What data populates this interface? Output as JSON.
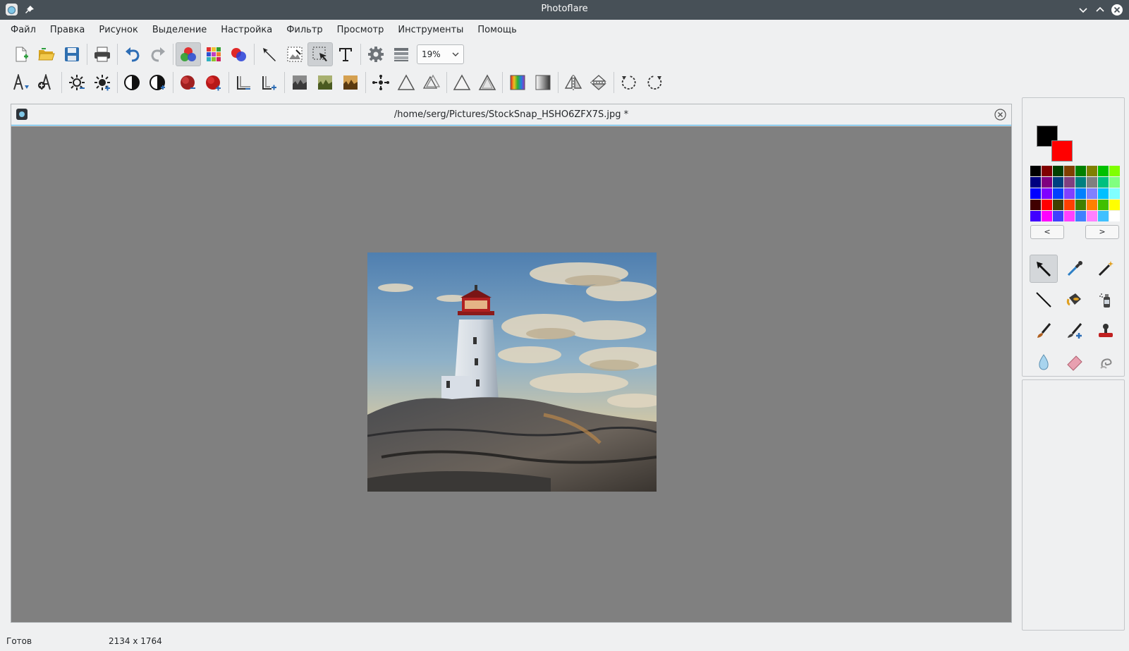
{
  "window": {
    "title": "Photoflare"
  },
  "menu": [
    "Файл",
    "Правка",
    "Рисунок",
    "Выделение",
    "Настройка",
    "Фильтр",
    "Просмотр",
    "Инструменты",
    "Помощь"
  ],
  "toolbar1": {
    "icons": [
      "new-file-icon",
      "open-folder-icon",
      "save-icon",
      "print-icon",
      "undo-icon",
      "redo-icon",
      "color-mode-icon",
      "palette-icon",
      "color-blend-icon",
      "pointer-icon",
      "crop-icon",
      "selection-icon",
      "text-icon",
      "settings-gear-icon",
      "layers-list-icon"
    ],
    "zoom_value": "19%"
  },
  "toolbar2": {
    "icons": [
      "text-down-icon",
      "text-up-icon",
      "brightness-down-icon",
      "brightness-up-icon",
      "contrast-down-icon",
      "contrast-up-icon",
      "saturation-down-icon",
      "saturation-up-icon",
      "gamma-down-icon",
      "gamma-up-icon",
      "levels-dark-icon",
      "levels-green-icon",
      "levels-warm-icon",
      "sharpen-icon",
      "triangle-outline-icon",
      "triangle-double-icon",
      "triangle-plain-icon",
      "triangle-shaded-icon",
      "gradient-color-icon",
      "gradient-gray-icon",
      "flip-horizontal-icon",
      "flip-vertical-icon",
      "rotate-ccw-icon",
      "rotate-cw-icon"
    ]
  },
  "document": {
    "title": "/home/serg/Pictures/StockSnap_HSHO6ZFX7S.jpg *"
  },
  "colors": {
    "primary": "#000000",
    "secondary": "#ff0000",
    "accent": "#3daee9",
    "canvas_bg": "#808080",
    "palette": [
      "#000000",
      "#800000",
      "#004000",
      "#804000",
      "#008000",
      "#808000",
      "#00c000",
      "#80ff00",
      "#000080",
      "#800080",
      "#004080",
      "#804080",
      "#008080",
      "#808080",
      "#00c080",
      "#80ff80",
      "#0000ff",
      "#8000ff",
      "#0040ff",
      "#8040ff",
      "#0080ff",
      "#8080ff",
      "#00c0ff",
      "#80ffff",
      "#400000",
      "#ff0000",
      "#404000",
      "#ff4000",
      "#408000",
      "#ff8000",
      "#40c000",
      "#ffff00",
      "#4000ff",
      "#ff00ff",
      "#4040ff",
      "#ff40ff",
      "#4080ff",
      "#ff80ff",
      "#40c0ff",
      "#ffffff"
    ],
    "prev_label": "<",
    "next_label": ">"
  },
  "tools": [
    "pointer-tool-icon",
    "eyedropper-tool-icon",
    "magic-wand-tool-icon",
    "line-tool-icon",
    "paint-bucket-tool-icon",
    "spray-can-tool-icon",
    "brush-tool-icon",
    "pen-plus-tool-icon",
    "stamp-tool-icon",
    "blur-drop-tool-icon",
    "eraser-tool-icon",
    "smudge-tool-icon"
  ],
  "status": {
    "state": "Готов",
    "dimensions": "2134 x 1764"
  }
}
